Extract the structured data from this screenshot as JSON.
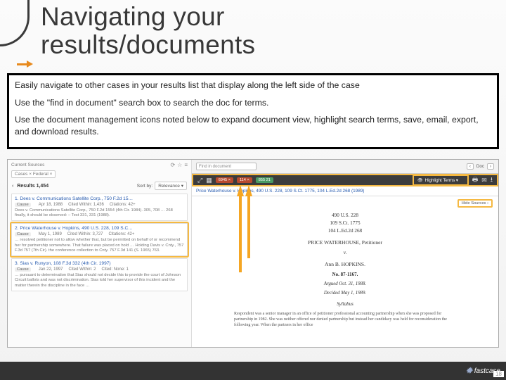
{
  "title_line1": "Navigating your",
  "title_line2": "results/documents",
  "instructions": {
    "p1": "Easily navigate to other cases in your results list that display along the left side of the case",
    "p2": "Use the \"find in document\" search box to search the doc for terms.",
    "p3": "Use the document management icons noted below to expand document view, highlight search terms, save, email, export, and download results."
  },
  "left_pane": {
    "source_label": "Current Sources",
    "source_value": "Cases × Federal ×",
    "back": "‹",
    "results_label": "Results 1,454",
    "sort_label": "Sort by:",
    "sort_value": "Relevance ▾",
    "cases": [
      {
        "title": "1. Dees v. Communications Satellite Corp., 750 F.2d 15…",
        "court": "Cause",
        "date": "Apr 18, 1988",
        "cited": "Cited Within: 1,436",
        "citing": "Citations: 42+",
        "desc": "Dees v. Communications Satellite Corp., 750 F.2d 1554 (4th Cir. 1984). 305, 708 … 268 finally, it should be observed: – Test 331, 331 (1988)."
      },
      {
        "title": "2. Price Waterhouse v. Hopkins, 490 U.S. 228, 109 S.C…",
        "court": "Cause",
        "date": "May 1, 1989",
        "cited": "Cited Within: 3,727",
        "citing": "Citations: 42+",
        "desc": "… resolved petitioner not to allow whether that, but be permitted on behalf of or recommend her for partnership somewhere. That failure was placed on hold … Holding Davis v. Cnty., 757 F.3d 757 (7th Cir). the conference collection to Cnty. 757 F.3d 141 (S. 1965) 763."
      },
      {
        "title": "3. Sias v. Runyon, 108 F.3d 332 (4th Cir. 1997)",
        "court": "Cause",
        "date": "Jan 22, 1997",
        "cited": "Cited Within: 2",
        "citing": "Cited: None: 1",
        "desc": "… pursuant to determination that Sias should not decide this to provide the court of Johnson Circuit ballots and was not discrimination. Sias told her supervisor of this incident and the matter therein the discipline in the face …"
      }
    ]
  },
  "center": {
    "find_placeholder": "Find in document",
    "pager_prev": "‹",
    "pager_label": "Doc",
    "pager_next": "›",
    "chips": [
      "6945 ×",
      "114 ×",
      "855 21"
    ],
    "citation": "Price Waterhouse v. Hopkins, 490 U.S. 228, 109 S.Ct. 1775, 104 L.Ed.2d 268 (1989)",
    "highlight_label": "Highlight Terms ▾",
    "hide_label": "Hide Sources ›"
  },
  "doc": {
    "cite1": "490 U.S. 228",
    "cite2": "109 S.Ct. 1775",
    "cite3": "104 L.Ed.2d 268",
    "party1": "PRICE WATERHOUSE, Petitioner",
    "vs": "v.",
    "party2": "Ann B. HOPKINS.",
    "caseno": "No. 87-1167.",
    "argued": "Argued Oct. 31, 1988.",
    "decided": "Decided May 1, 1989.",
    "syllabus": "Syllabus",
    "para": "Respondent was a senior manager in an office of petitioner professional accounting partnership when she was proposed for partnership in 1982. She was neither offered nor denied partnership but instead her candidacy was held for reconsideration the following year. When the partners in her office"
  },
  "footer": {
    "logo": "fastcase",
    "page": "18"
  }
}
